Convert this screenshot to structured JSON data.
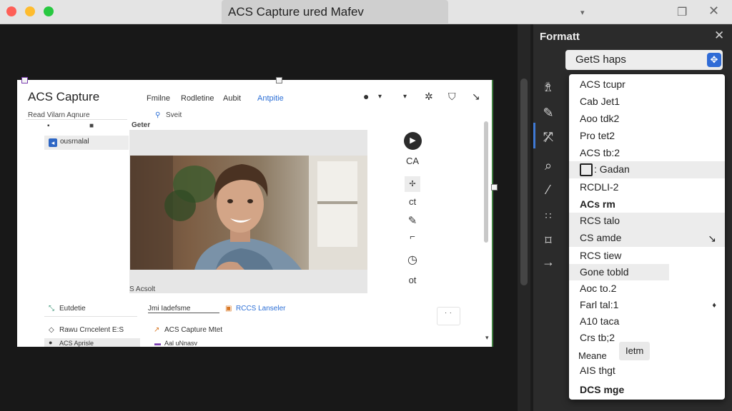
{
  "window": {
    "title": "ACS Capture ured Mafev"
  },
  "app": {
    "title": "ACS Capture",
    "menu": [
      "Fmilne",
      "Rodletine",
      "Aubit",
      "Antpitie"
    ],
    "left_tab": "Read Vilarn Aqnure",
    "search_label": "Sveit",
    "section_header": "Geter",
    "sidebar_item": "ousrnalal",
    "image_caption": "S Acsolt",
    "tools": [
      "CA",
      "ct",
      "ot"
    ],
    "bottom": [
      {
        "label": "Eutdetie"
      },
      {
        "label": "Jmi Iadefsme"
      },
      {
        "label": "RCCS Lanseler"
      },
      {
        "label": "Rawu Crncelent E:S"
      },
      {
        "label": "ACS Capture Mtet"
      },
      {
        "label": "ACS Aprisle"
      },
      {
        "label": "Aal uNnasv"
      }
    ],
    "dots_button": "˙ ˙"
  },
  "panel": {
    "title": "Formatt",
    "combo_value": "GetS haps",
    "items": [
      {
        "label": "ACS tcupr",
        "highlight": false,
        "bold": false
      },
      {
        "label": "Cab Jet1",
        "highlight": false,
        "bold": false
      },
      {
        "label": "Aoo tdk2",
        "highlight": false,
        "bold": false
      },
      {
        "label": "Pro tet2",
        "highlight": false,
        "bold": false
      },
      {
        "label": "ACS tb:2",
        "highlight": false,
        "bold": false
      },
      {
        "label": ": Gadan",
        "highlight": true,
        "bold": false,
        "checkbox": true
      },
      {
        "label": "RCDLI-2",
        "highlight": false,
        "bold": false
      },
      {
        "label": "ACs rm",
        "highlight": false,
        "bold": true
      },
      {
        "label": "RCS talo",
        "highlight": true,
        "bold": false
      },
      {
        "label": "CS amde",
        "highlight": true,
        "bold": false,
        "arrow": true
      },
      {
        "label": "RCS tiew",
        "highlight": false,
        "bold": false
      },
      {
        "label": "Gone tobld",
        "highlight": true,
        "bold": false
      },
      {
        "label": "Aoc to.2",
        "highlight": false,
        "bold": false
      },
      {
        "label": "Farl tal:1",
        "highlight": false,
        "bold": false,
        "dot": true
      },
      {
        "label": "A10 taca",
        "highlight": false,
        "bold": false
      },
      {
        "label": "Crs tb;2",
        "highlight": false,
        "bold": false
      }
    ],
    "btn_left": "Meane",
    "btn_right": "Ietm",
    "footer_1": "AIS thgt",
    "footer_2": "DCS mge"
  },
  "colors": {
    "accent": "#2f6bd6",
    "panel_bg": "#2b2b2b",
    "doc_bg": "#ffffff"
  }
}
